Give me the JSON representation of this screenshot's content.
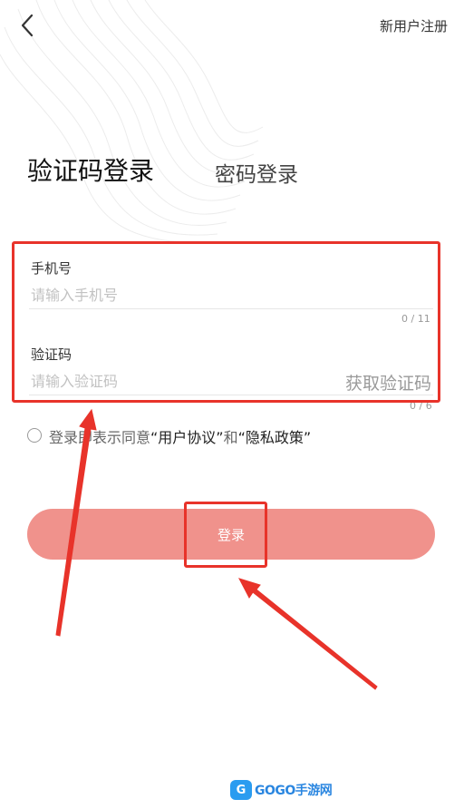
{
  "header": {
    "register_label": "新用户注册"
  },
  "tabs": {
    "sms_login_label": "验证码登录",
    "password_login_label": "密码登录"
  },
  "form": {
    "phone": {
      "label": "手机号",
      "placeholder": "请输入手机号",
      "value": "",
      "counter": "0 / 11"
    },
    "code": {
      "label": "验证码",
      "placeholder": "请输入验证码",
      "value": "",
      "counter": "0 / 6",
      "get_code_label": "获取验证码"
    }
  },
  "agreement": {
    "prefix": "登录即表示同意",
    "user_agreement": "“用户协议”",
    "connector": "和",
    "privacy_policy": "“隐私政策”",
    "checked": false
  },
  "login_button_label": "登录",
  "watermark": {
    "badge": "G",
    "brand": "GOGO",
    "suffix": "手游网"
  },
  "colors": {
    "accent": "#f0928c",
    "annotation": "#e8332a",
    "watermark": "#2a86e0"
  },
  "icons": {
    "back": "chevron-left-icon",
    "radio": "radio-unchecked-icon"
  }
}
